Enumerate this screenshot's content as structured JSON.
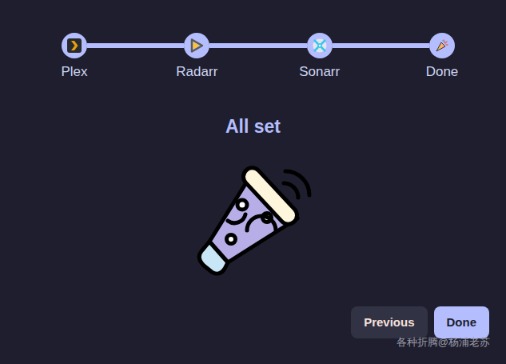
{
  "steps": [
    {
      "label": "Plex",
      "completed": true
    },
    {
      "label": "Radarr",
      "completed": true
    },
    {
      "label": "Sonarr",
      "completed": true
    },
    {
      "label": "Done",
      "completed": true
    }
  ],
  "title": "All set",
  "buttons": [
    {
      "label": "Previous",
      "kind": "secondary"
    },
    {
      "label": "Done",
      "kind": "primary"
    }
  ],
  "watermark": "各种折腾@杨浦老苏"
}
